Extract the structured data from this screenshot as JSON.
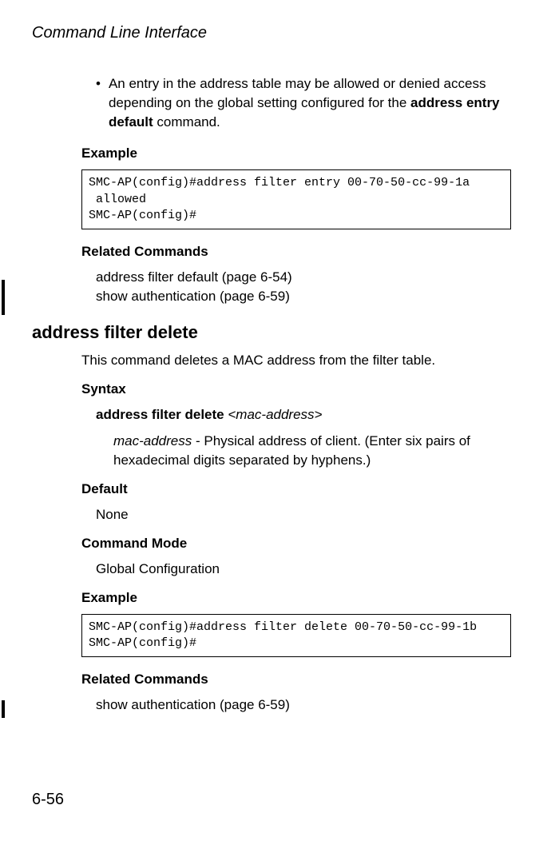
{
  "header": "Command Line Interface",
  "bullet": {
    "marker": "•",
    "text_before": "An entry in the address table may be allowed or denied access depending on the global setting configured for the ",
    "bold": "address entry default",
    "text_after": " command."
  },
  "labels": {
    "example": "Example",
    "related_commands": "Related Commands",
    "syntax": "Syntax",
    "default": "Default",
    "command_mode": "Command Mode"
  },
  "example1": "SMC-AP(config)#address filter entry 00-70-50-cc-99-1a\n allowed\nSMC-AP(config)#",
  "related1": {
    "line1": "address filter default (page 6-54)",
    "line2": "show authentication (page 6-59)"
  },
  "command2": {
    "heading": "address filter delete",
    "desc": "This command deletes a MAC address from the filter table.",
    "syntax_bold": "address filter delete",
    "syntax_italic": "<mac-address>",
    "param_italic": "mac-address",
    "param_text": " - Physical address of client. (Enter six pairs of hexadecimal digits separated by hyphens.)",
    "default": "None",
    "command_mode": "Global Configuration",
    "example": "SMC-AP(config)#address filter delete 00-70-50-cc-99-1b\nSMC-AP(config)#",
    "related": "show authentication (page 6-59)"
  },
  "page_number": "6-56"
}
